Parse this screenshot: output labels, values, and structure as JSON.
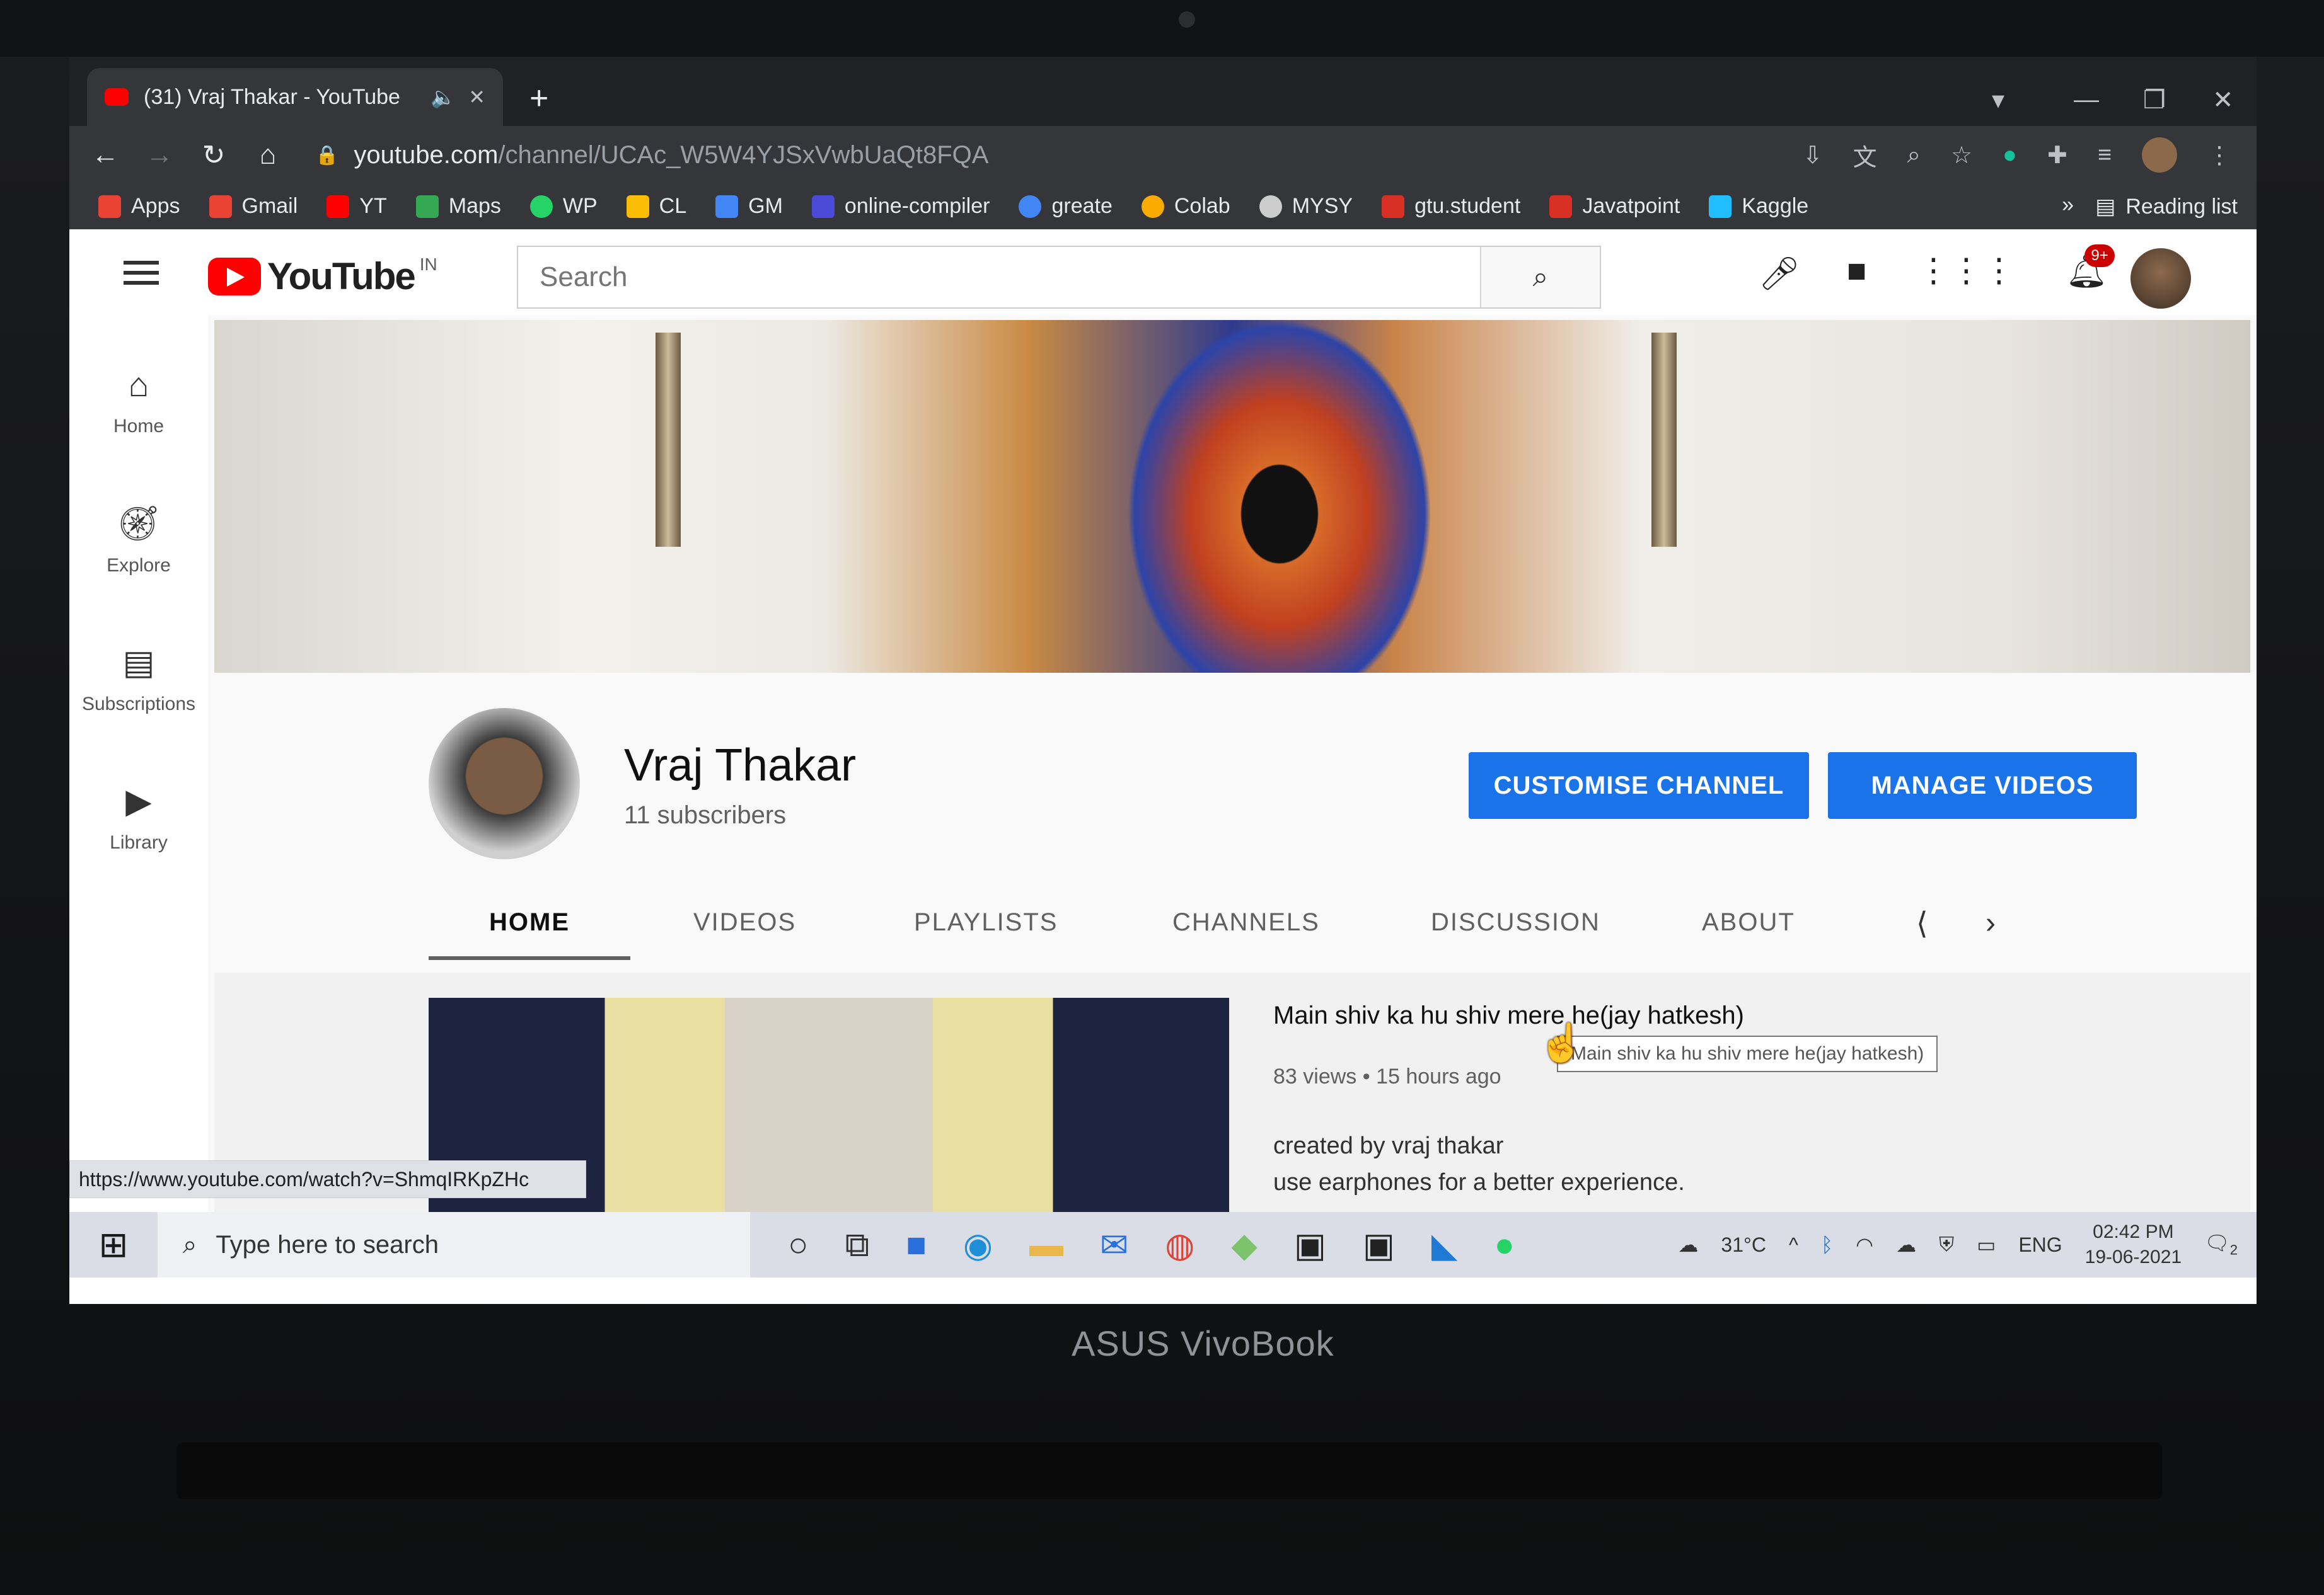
{
  "browser": {
    "tab_title": "(31) Vraj Thakar - YouTube",
    "new_tab_label": "+",
    "url_host": "youtube.com",
    "url_path": "/channel/UCAc_W5W4YJSxVwbUaQt8FQA",
    "bookmarks": [
      {
        "label": "Apps",
        "color": "#ea4335"
      },
      {
        "label": "Gmail",
        "color": "#ea4335"
      },
      {
        "label": "YT",
        "color": "#ff0000"
      },
      {
        "label": "Maps",
        "color": "#34a853"
      },
      {
        "label": "WP",
        "color": "#25d366"
      },
      {
        "label": "CL",
        "color": "#fbbc04"
      },
      {
        "label": "GM",
        "color": "#4285f4"
      },
      {
        "label": "online-compiler",
        "color": "#4b4bd8"
      },
      {
        "label": "greate",
        "color": "#4285f4"
      },
      {
        "label": "Colab",
        "color": "#f9ab00"
      },
      {
        "label": "MYSY",
        "color": "#cccccc"
      },
      {
        "label": "gtu.student",
        "color": "#d93025"
      },
      {
        "label": "Javatpoint",
        "color": "#d93025"
      },
      {
        "label": "Kaggle",
        "color": "#20beff"
      }
    ],
    "more_bookmarks": "»",
    "reading_list": "Reading list"
  },
  "youtube": {
    "logo_text": "YouTube",
    "country_code": "IN",
    "search_placeholder": "Search",
    "notification_badge": "9+",
    "sidebar": [
      {
        "label": "Home",
        "icon": "home-icon"
      },
      {
        "label": "Explore",
        "icon": "compass-icon"
      },
      {
        "label": "Subscriptions",
        "icon": "subscriptions-icon"
      },
      {
        "label": "Library",
        "icon": "library-icon"
      }
    ],
    "channel": {
      "name": "Vraj Thakar",
      "subscribers": "11 subscribers",
      "customise_button": "CUSTOMISE CHANNEL",
      "manage_button": "MANAGE VIDEOS",
      "accent_color": "#1a73e8"
    },
    "tabs": [
      "HOME",
      "VIDEOS",
      "PLAYLISTS",
      "CHANNELS",
      "DISCUSSION",
      "ABOUT"
    ],
    "featured_video": {
      "title": "Main shiv ka hu shiv mere he(jay hatkesh)",
      "meta": "83 views • 15 hours ago",
      "description_line1": "created by vraj thakar",
      "description_line2": "use earphones for a better experience.",
      "tooltip": "Main shiv ka hu shiv mere he(jay hatkesh)"
    },
    "status_url": "https://www.youtube.com/watch?v=ShmqIRKpZHc"
  },
  "taskbar": {
    "search_placeholder": "Type here to search",
    "temperature": "31°C",
    "language": "ENG",
    "time": "02:42 PM",
    "date": "19-06-2021",
    "notification_count": "2"
  },
  "device": {
    "brand": "ASUS VivoBook"
  }
}
